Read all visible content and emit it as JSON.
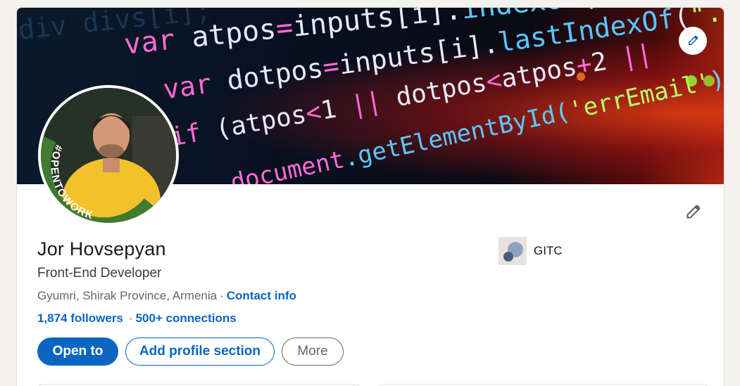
{
  "banner": {
    "code_lines": [
      "div divs[i];",
      "var atpos=inputs[i].indexOf(\"@\");",
      "var dotpos=inputs[i].lastIndexOf(\".\");",
      "if (atpos<1 || dotpos<atpos+2 ||",
      "document.getElementById('errEmail')"
    ]
  },
  "avatar": {
    "badge_text": "#OPENTOWORK",
    "ring_color": "#3f7b31"
  },
  "profile": {
    "name": "Jor Hovsepyan",
    "headline": "Front-End Developer",
    "location": "Gyumri, Shirak Province, Armenia",
    "separator": "·",
    "contact_label": "Contact info",
    "followers": "1,874 followers",
    "connections": "500+ connections",
    "network_sep": "·"
  },
  "company": {
    "name": "GITC"
  },
  "actions": {
    "open_to": "Open to",
    "add_section": "Add profile section",
    "more": "More"
  },
  "colors": {
    "accent": "#0a66c2",
    "background": "#f3f2ef",
    "text_primary": "#191919",
    "text_secondary": "#666666"
  }
}
